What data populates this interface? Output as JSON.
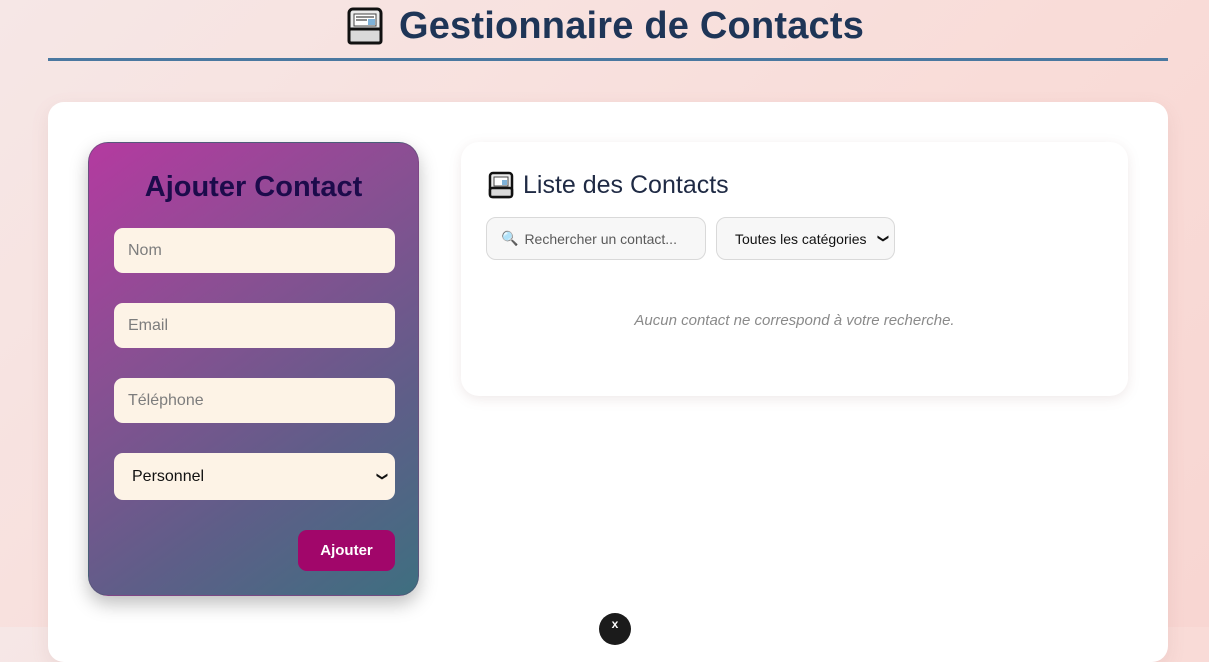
{
  "header": {
    "icon": "newspaper-icon",
    "title": "Gestionnaire de Contacts"
  },
  "form": {
    "title": "Ajouter Contact",
    "name_placeholder": "Nom",
    "email_placeholder": "Email",
    "phone_placeholder": "Téléphone",
    "category_selected": "Personnel",
    "submit_label": "Ajouter"
  },
  "list": {
    "icon": "newspaper-icon",
    "title": "Liste des Contacts",
    "search_placeholder": "Rechercher un contact...",
    "search_icon": "🔍",
    "category_filter_selected": "Toutes les catégories",
    "empty_message": "Aucun contact ne correspond à votre recherche."
  },
  "colors": {
    "title": "#1e3557",
    "accent_button": "#a1066a",
    "form_gradient_start": "#b43aa0",
    "form_gradient_end": "#3e6f80"
  }
}
